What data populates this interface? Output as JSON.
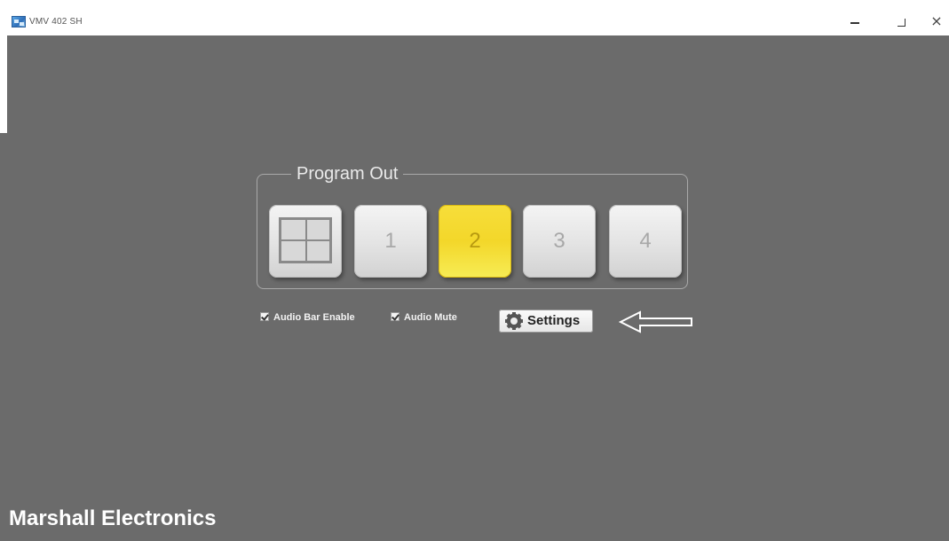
{
  "window": {
    "title": "VMV 402 SH",
    "icon": "app-icon",
    "controls": [
      "minimize-icon",
      "maximize-icon",
      "close-icon"
    ]
  },
  "program_out": {
    "legend": "Program Out",
    "buttons": [
      {
        "label": "",
        "icon": "quad-view-icon",
        "active": false
      },
      {
        "label": "1",
        "active": false
      },
      {
        "label": "2",
        "active": true
      },
      {
        "label": "3",
        "active": false
      },
      {
        "label": "4",
        "active": false
      }
    ]
  },
  "options": {
    "audio_bar_enable": {
      "label": "Audio Bar Enable",
      "checked": true
    },
    "audio_mute": {
      "label": "Audio Mute",
      "checked": true
    }
  },
  "settings": {
    "label": "Settings",
    "icon": "gear-icon"
  },
  "annotation": {
    "icon": "arrow-left-icon"
  },
  "footer": {
    "brand": "Marshall Electronics"
  },
  "colors": {
    "background": "#6b6b6b",
    "active_button": "#f3d72a",
    "inactive_button": "#e3e3e3"
  }
}
